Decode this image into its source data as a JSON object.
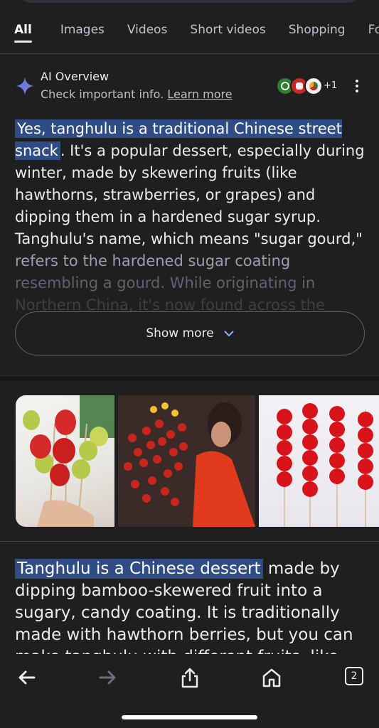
{
  "tabs": [
    "All",
    "Images",
    "Videos",
    "Short videos",
    "Shopping",
    "Foru"
  ],
  "ai_overview": {
    "title": "AI Overview",
    "subtitle_prefix": "Check important info. ",
    "learn_more": "Learn more",
    "source_count": "+1"
  },
  "answer": {
    "highlight": "Yes, tanghulu is a traditional Chinese street snack",
    "text": ". It's a popular dessert, especially during winter, made by skewering fruits (like hawthorns, strawberries, or grapes) and dipping them in a hardened sugar syrup. Tanghulu's name, which means \"sugar gourd,\"",
    "fade1": " refers to the hardened sugar coating",
    "fade2": " resembling a gourd. While originating in",
    "fade3": " Northern China, it's now found across the"
  },
  "show_more": "Show more",
  "snippet": {
    "highlight": "Tanghulu is a Chinese dessert",
    "text": " made by dipping bamboo-skewered fruit into a sugary, candy coating. It is traditionally made with hawthorn berries, but you can",
    "cut": " make tanghulu with different fruits, like"
  },
  "bottom_nav": {
    "tab_count": "2"
  },
  "colors": {
    "background": "#1f1f1f",
    "highlight": "#2f4c85",
    "accent_blue": "#4285f4"
  }
}
